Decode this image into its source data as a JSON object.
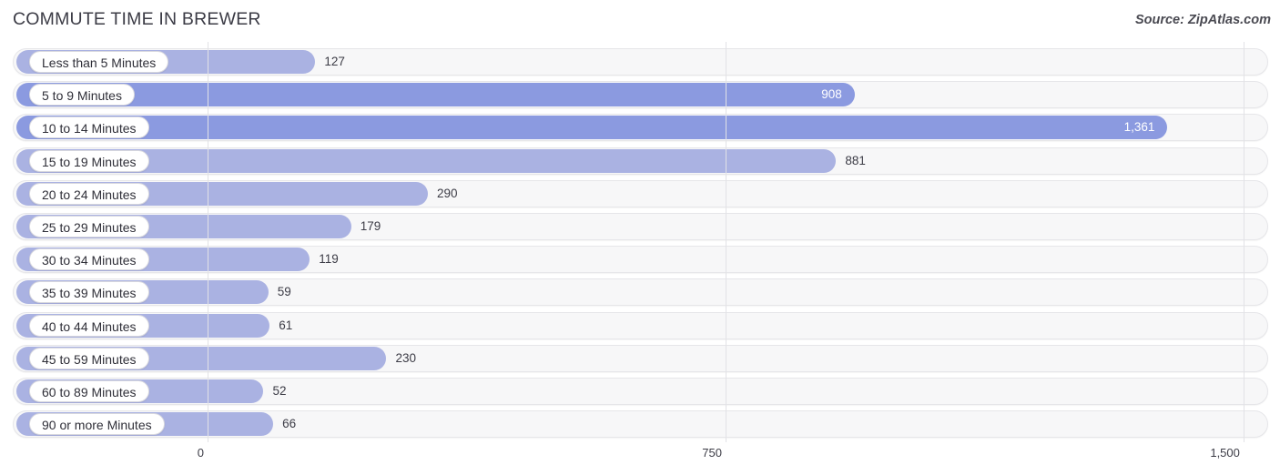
{
  "header": {
    "title": "COMMUTE TIME IN BREWER",
    "source": "Source: ZipAtlas.com"
  },
  "chart_data": {
    "type": "bar",
    "orientation": "horizontal",
    "title": "COMMUTE TIME IN BREWER",
    "xlabel": "",
    "ylabel": "",
    "xlim": [
      0,
      1500
    ],
    "grid": true,
    "gridline_values": [
      0,
      750,
      1500
    ],
    "tick_labels": [
      "0",
      "750",
      "1,500"
    ],
    "legend": null,
    "categories": [
      "Less than 5 Minutes",
      "5 to 9 Minutes",
      "10 to 14 Minutes",
      "15 to 19 Minutes",
      "20 to 24 Minutes",
      "25 to 29 Minutes",
      "30 to 34 Minutes",
      "35 to 39 Minutes",
      "40 to 44 Minutes",
      "45 to 59 Minutes",
      "60 to 89 Minutes",
      "90 or more Minutes"
    ],
    "values": [
      127,
      908,
      1361,
      881,
      290,
      179,
      119,
      59,
      61,
      230,
      52,
      66
    ],
    "value_labels": [
      "127",
      "908",
      "1,361",
      "881",
      "290",
      "179",
      "119",
      "59",
      "61",
      "230",
      "52",
      "66"
    ],
    "colors": {
      "bar_light": "#aab2e2",
      "bar_dark": "#8b9ae0",
      "track": "#f7f7f8",
      "track_border": "#e6e6e9",
      "gridline": "#e2e2e6",
      "text": "#3c3c46",
      "value_inside": "#ffffff"
    }
  }
}
